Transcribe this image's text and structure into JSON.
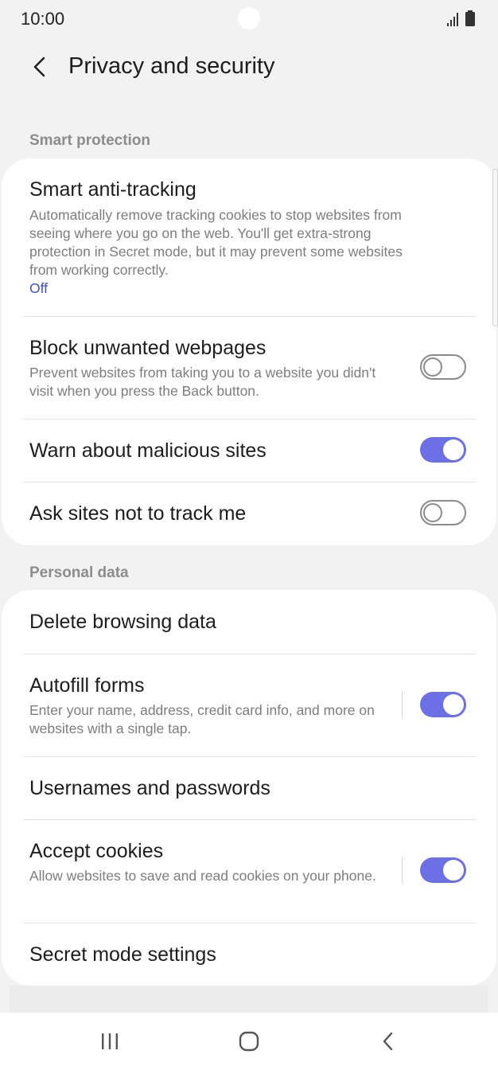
{
  "status": {
    "time": "10:00"
  },
  "header": {
    "title": "Privacy and security"
  },
  "sections": {
    "smart_protection": {
      "label": "Smart protection"
    },
    "personal_data": {
      "label": "Personal data"
    }
  },
  "smart_protection": {
    "anti_tracking": {
      "title": "Smart anti-tracking",
      "subtitle": "Automatically remove tracking cookies to stop websites from seeing where you go on the web. You'll get extra-strong protection in Secret mode, but it may prevent some websites from working correctly.",
      "value": "Off"
    },
    "block_unwanted": {
      "title": "Block unwanted webpages",
      "subtitle": "Prevent websites from taking you to a website you didn't visit when you press the Back button.",
      "enabled": false
    },
    "warn_malicious": {
      "title": "Warn about malicious sites",
      "enabled": true
    },
    "do_not_track": {
      "title": "Ask sites not to track me",
      "enabled": false
    }
  },
  "personal_data": {
    "delete_browsing": {
      "title": "Delete browsing data"
    },
    "autofill": {
      "title": "Autofill forms",
      "subtitle": "Enter your name, address, credit card info, and more on websites with a single tap.",
      "enabled": true
    },
    "usernames": {
      "title": "Usernames and passwords"
    },
    "cookies": {
      "title": "Accept cookies",
      "subtitle": "Allow websites to save and read cookies on your phone.",
      "enabled": true
    },
    "secret_mode": {
      "title": "Secret mode settings"
    }
  },
  "colors": {
    "accent": "#6b70e6",
    "link": "#3e4fc4",
    "background": "#f2f2f2"
  },
  "icons": {
    "signal": "signal-icon",
    "battery": "battery-icon",
    "back": "back-arrow-icon",
    "nav_recents": "recents-icon",
    "nav_home": "home-icon",
    "nav_back": "nav-back-icon"
  }
}
